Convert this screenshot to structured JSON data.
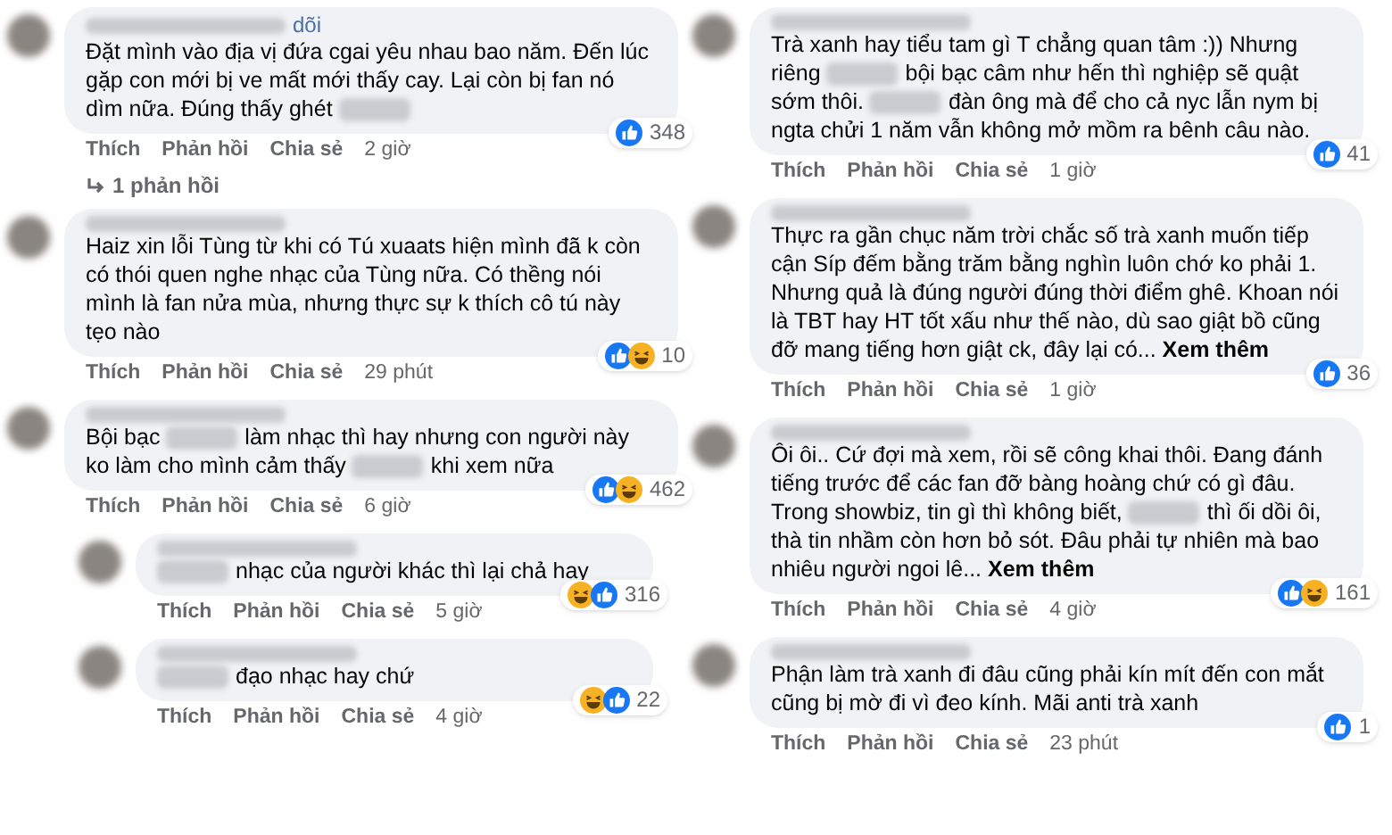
{
  "columns": [
    {
      "comments": [
        {
          "header_text": "dõi",
          "segments": [
            {
              "kind": "text",
              "text": "Đặt mình vào địa vị đứa cgai yêu nhau bao năm. Đến lúc gặp con mới bị ve mất mới thấy cay. Lại còn bị fan nó dìm nữa. Đúng thấy ghét"
            },
            {
              "kind": "blur"
            }
          ],
          "reactions": [
            {
              "kind": "like"
            }
          ],
          "count": "348",
          "actions": [
            "Thích",
            "Phản hồi",
            "Chia sẻ"
          ],
          "time": "2 giờ",
          "replies_link": "1 phản hồi"
        },
        {
          "segments": [
            {
              "kind": "text",
              "text": "Haiz xin lỗi Tùng từ khi có Tú xuaats hiện mình đã k còn có thói quen nghe nhạc của Tùng nữa. Có thềng nói mình là fan nửa mùa, nhưng thực sự k thích cô tú này tẹo nào"
            }
          ],
          "reactions": [
            {
              "kind": "like"
            },
            {
              "kind": "haha"
            }
          ],
          "count": "10",
          "actions": [
            "Thích",
            "Phản hồi",
            "Chia sẻ"
          ],
          "time": "29 phút"
        },
        {
          "segments": [
            {
              "kind": "text",
              "text": "Bội bạc"
            },
            {
              "kind": "blur"
            },
            {
              "kind": "text",
              "text": "làm nhạc thì hay nhưng con người này ko làm cho mình cảm thấy"
            },
            {
              "kind": "blur"
            },
            {
              "kind": "text",
              "text": "khi xem nữa"
            }
          ],
          "reactions": [
            {
              "kind": "like"
            },
            {
              "kind": "haha"
            }
          ],
          "count": "462",
          "actions": [
            "Thích",
            "Phản hồi",
            "Chia sẻ"
          ],
          "time": "6 giờ",
          "children": [
            {
              "segments": [
                {
                  "kind": "blur"
                },
                {
                  "kind": "text",
                  "text": "nhạc của người khác thì lại chả hay"
                }
              ],
              "reactions": [
                {
                  "kind": "haha"
                },
                {
                  "kind": "like"
                }
              ],
              "count": "316",
              "actions": [
                "Thích",
                "Phản hồi",
                "Chia sẻ"
              ],
              "time": "5 giờ"
            },
            {
              "segments": [
                {
                  "kind": "blur"
                },
                {
                  "kind": "text",
                  "text": "đạo nhạc hay chứ"
                }
              ],
              "reactions": [
                {
                  "kind": "haha"
                },
                {
                  "kind": "like"
                }
              ],
              "count": "22",
              "actions": [
                "Thích",
                "Phản hồi",
                "Chia sẻ"
              ],
              "time": "4 giờ"
            }
          ]
        }
      ]
    },
    {
      "comments": [
        {
          "segments": [
            {
              "kind": "text",
              "text": "Trà xanh hay tiểu tam gì T chẳng quan tâm :)) Nhưng riêng"
            },
            {
              "kind": "blur"
            },
            {
              "kind": "text",
              "text": "bội bạc câm như hến thì nghiệp sẽ quật sớm thôi."
            },
            {
              "kind": "blur"
            },
            {
              "kind": "text",
              "text": "đàn ông mà để cho cả nyc lẫn nym bị ngta chửi 1 năm vẫn không mở mồm ra bênh câu nào."
            }
          ],
          "reactions": [
            {
              "kind": "like"
            }
          ],
          "count": "41",
          "actions": [
            "Thích",
            "Phản hồi",
            "Chia sẻ"
          ],
          "time": "1 giờ"
        },
        {
          "segments": [
            {
              "kind": "text",
              "text": "Thực ra gần chục năm trời chắc số trà xanh muốn tiếp cận Síp đếm bằng trăm bằng nghìn luôn chớ ko phải 1. Nhưng quả là đúng người đúng thời điểm ghê. Khoan nói là TBT hay HT tốt xấu như thế nào, dù sao giật bồ cũng đỡ mang tiếng hơn giật ck, đây lại có... **Xem thêm**"
            }
          ],
          "reactions": [
            {
              "kind": "like"
            }
          ],
          "count": "36",
          "actions": [
            "Thích",
            "Phản hồi",
            "Chia sẻ"
          ],
          "time": "1 giờ"
        },
        {
          "segments": [
            {
              "kind": "text",
              "text": "Ôi ôi.. Cứ đợi mà xem, rồi sẽ công khai thôi. Đang đánh tiếng trước để các fan đỡ bàng hoàng chứ có gì đâu. Trong showbiz, tin gì thì không biết,"
            },
            {
              "kind": "blur"
            },
            {
              "kind": "text",
              "text": "thì ối dồi ôi, thà tin nhầm còn hơn bỏ sót. Đâu phải tự nhiên mà bao nhiêu người ngoi lê... **Xem thêm**"
            }
          ],
          "reactions": [
            {
              "kind": "like"
            },
            {
              "kind": "haha"
            }
          ],
          "count": "161",
          "actions": [
            "Thích",
            "Phản hồi",
            "Chia sẻ"
          ],
          "time": "4 giờ"
        },
        {
          "segments": [
            {
              "kind": "text",
              "text": "Phận làm trà xanh đi đâu cũng phải kín mít đến con mắt cũng bị mờ đi vì đeo kính. Mãi anti trà xanh"
            }
          ],
          "reactions": [
            {
              "kind": "like"
            }
          ],
          "count": "1",
          "actions": [
            "Thích",
            "Phản hồi",
            "Chia sẻ"
          ],
          "time": "23 phút"
        }
      ]
    }
  ]
}
